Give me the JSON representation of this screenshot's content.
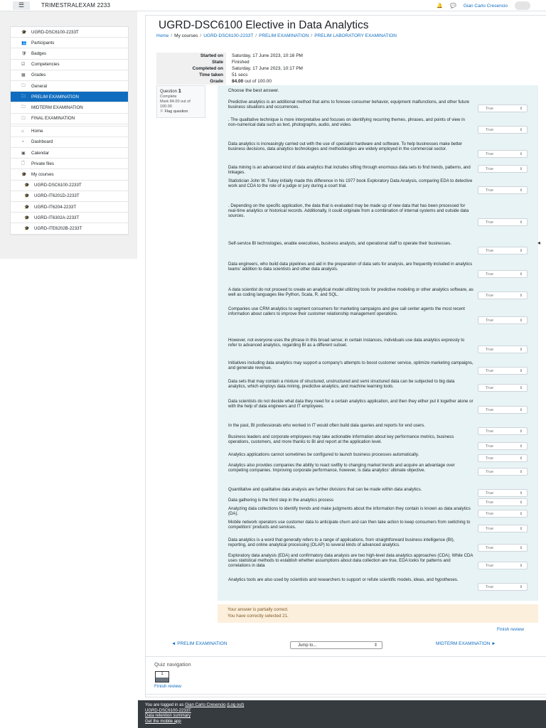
{
  "header": {
    "site_name": "TRIMESTRALEXAM 2233",
    "menu_icon": "hamburger-icon",
    "user_name": "Gian Carlo Cresencio"
  },
  "sidebar": {
    "items": [
      {
        "label": "UGRD-DSC6100-2233T",
        "icon": "graduation-cap-icon",
        "style": "top"
      },
      {
        "label": "Participants",
        "icon": "users-icon",
        "style": "top"
      },
      {
        "label": "Badges",
        "icon": "badge-icon",
        "style": "top"
      },
      {
        "label": "Competencies",
        "icon": "checklist-icon",
        "style": "top"
      },
      {
        "label": "Grades",
        "icon": "table-icon",
        "style": "top"
      },
      {
        "label": "General",
        "icon": "folder-icon",
        "style": "top"
      },
      {
        "label": "PRELIM EXAMINATION",
        "icon": "folder-icon",
        "style": "active"
      },
      {
        "label": "MIDTERM EXAMINATION",
        "icon": "folder-icon",
        "style": "top"
      },
      {
        "label": "FINAL EXAMINATION",
        "icon": "folder-icon",
        "style": "top"
      },
      {
        "label": "Home",
        "icon": "home-icon",
        "style": "gap"
      },
      {
        "label": "Dashboard",
        "icon": "dashboard-icon",
        "style": "top"
      },
      {
        "label": "Calendar",
        "icon": "calendar-icon",
        "style": "top"
      },
      {
        "label": "Private files",
        "icon": "file-icon",
        "style": "top"
      },
      {
        "label": "My courses",
        "icon": "graduation-cap-icon",
        "style": "top"
      },
      {
        "label": "UGRD-DSC6100-2233T",
        "icon": "graduation-cap-icon",
        "style": "sub"
      },
      {
        "label": "UGRD-IT6201D-2233T",
        "icon": "graduation-cap-icon",
        "style": "sub"
      },
      {
        "label": "UGRD-IT6204-2233T",
        "icon": "graduation-cap-icon",
        "style": "sub"
      },
      {
        "label": "UGRD-IT6302A-2233T",
        "icon": "graduation-cap-icon",
        "style": "sub"
      },
      {
        "label": "UGRD-ITE6202B-2233T",
        "icon": "graduation-cap-icon",
        "style": "sub"
      }
    ]
  },
  "page": {
    "title": "UGRD-DSC6100 Elective in Data Analytics",
    "breadcrumb": [
      "Home",
      "My courses",
      "UGRD-DSC6100-2233T",
      "PRELIM EXAMINATION",
      "PRELIM LABORATORY EXAMINATION"
    ]
  },
  "summary": [
    {
      "label": "Started on",
      "value": "Saturday, 17 June 2023, 10:16 PM"
    },
    {
      "label": "State",
      "value": "Finished"
    },
    {
      "label": "Completed on",
      "value": "Saturday, 17 June 2023, 10:17 PM"
    },
    {
      "label": "Time taken",
      "value": "51 secs"
    },
    {
      "label": "Grade",
      "value_bold": "84.00",
      "value_rest": " out of 100.00"
    }
  ],
  "question_info": {
    "question_word": "Question",
    "number": "1",
    "state": "Complete",
    "mark": "Mark 84.00 out of 100.00",
    "flag": "Flag question"
  },
  "question": {
    "prompt": "Choose the best answer.",
    "statements": [
      {
        "text": "Predictive analytics is an additional method that aims to foresee consumer behavior, equipment malfunctions, and other future business situations and occurrences.",
        "answer": "True"
      },
      {
        "text": ". The qualitative technique is more interpretative and focuses on identifying recurring themes, phrases, and points of view in non-numerical data such as text, photographs, audio, and video.",
        "answer": "True"
      },
      {
        "text": "Data analytics is increasingly carried out with the use of specialist hardware and software. To help businesses make better business decisions, data analytics technologies and methodologies are widely employed in the commercial sector.",
        "answer": "True"
      },
      {
        "text": "Data mining is an advanced kind of data analytics that includes sifting through enormous data sets to find trends, patterns, and linkages.",
        "answer": "True"
      },
      {
        "text": "Statistician John W. Tukey initially made this difference in his 1977 book Exploratory Data Analysis, comparing EDA to detective work and CDA to the role of a judge or jury during a court trial.",
        "answer": "True"
      },
      {
        "text": ". Depending on the specific application, the data that is evaluated may be made up of new data that has been processed for real-time analytics or historical records. Additionally, it could originate from a combination of internal systems and outside data sources.",
        "answer": "True"
      },
      {
        "text": "Self-service BI technologies, enable executives, business analysts, and operational staff to operate their businesses.",
        "answer": "True"
      },
      {
        "text": "Data engineers, who build data pipelines and aid in the preparation of data sets for analysis, are frequently included in analytics teams' addition to data scientists and other data analysts.",
        "answer": "True"
      },
      {
        "text": "A data scientist do not proceed to create an analytical model utilizing tools for predictive modeling or other analytics software, as well as coding languages like Python, Scala, R, and SQL.",
        "answer": "True"
      },
      {
        "text": "Companies use CRM analytics to segment consumers for marketing campaigns and give call center agents the most recent information about callers to improve their customer relationship management operations.",
        "answer": "True"
      },
      {
        "text": "However, not everyone uses the phrase in this broad sense; in certain instances, individuals use data analytics expressly to refer to advanced analytics, regarding BI as a different subset.",
        "answer": "True"
      },
      {
        "text": "Initiatives including data analytics may support a company's attempts to boost customer service, optimize marketing campaigns, and generate revenue.",
        "answer": "True"
      },
      {
        "text": "Data sets that may contain a mixture of structured, unstructured and semi structured data can be subjected to big data analytics, which employs data mining, predictive analytics, and machine learning tools.",
        "answer": "True"
      },
      {
        "text": "Data scientists do not decide what data they need for a certain analytics application, and then they either put it together alone or with the help of data engineers and IT employees.",
        "answer": "True"
      },
      {
        "text": "In the past, BI professionals who worked in IT would often build data queries and reports for end users.",
        "answer": "True"
      },
      {
        "text": "Business leaders and corporate employees may take actionable information about key performance metrics, business operations, customers, and more thanks to BI and report at the application level.",
        "answer": "True"
      },
      {
        "text": "Analytics applications cannot sometimes be configured to launch business processes automatically.",
        "answer": "True"
      },
      {
        "text": "Analytics also provides companies the ability to react swiftly to changing market trends and acquire an advantage over competing companies. Improving corporate performance, however, is data analytics' ultimate objective.",
        "answer": "True"
      },
      {
        "text": "Quantitative and qualitative data analysis are further divisions that can be made within data analytics.",
        "answer": "True"
      },
      {
        "text": "Data gathering is the third step in the analytics process",
        "answer": "True"
      },
      {
        "text": "Analyzing data collections to identify trends and make judgments about the information they contain is known as data analytics (DA).",
        "answer": "True"
      },
      {
        "text": "Mobile network operators use customer data to anticipate churn and can then take action to keep consumers from switching to competitors' products and services.",
        "answer": "True"
      },
      {
        "text": "Data analytics is a word that generally refers to a range of applications, from straightforward business intelligence (BI), reporting, and online analytical processing (OLAP) to several kinds of advanced analytics.",
        "answer": "True"
      },
      {
        "text": "Exploratory data analysis (EDA) and confirmatory data analysis are two high-level data analytics approaches (CDA). While CDA uses statistical methods to establish whether assumptions about data collection are true, EDA looks for patterns and correlations in data",
        "answer": "True"
      },
      {
        "text": "Analytics tools are also used by scientists and researchers to support or refute scientific models, ideas, and hypotheses.",
        "answer": "True"
      }
    ]
  },
  "feedback": {
    "line1": "Your answer is partially correct.",
    "line2": "You have correctly selected 21."
  },
  "navigation": {
    "finish_review": "Finish review",
    "prev": "◄ PRELIM EXAMINATION",
    "jump": "Jump to...",
    "next": "MIDTERM EXAMINATION ►"
  },
  "quiz_nav": {
    "title": "Quiz navigation",
    "button": "1",
    "finish_review": "Finish review"
  },
  "footer": {
    "logged_in_prefix": "You are logged in as ",
    "user": "Gian Carlo Cresencio",
    "logout": "(Log out)",
    "course": "UGRD-DSC6100-2233T",
    "retention": "Data retention summary",
    "app": "Get the mobile app"
  }
}
